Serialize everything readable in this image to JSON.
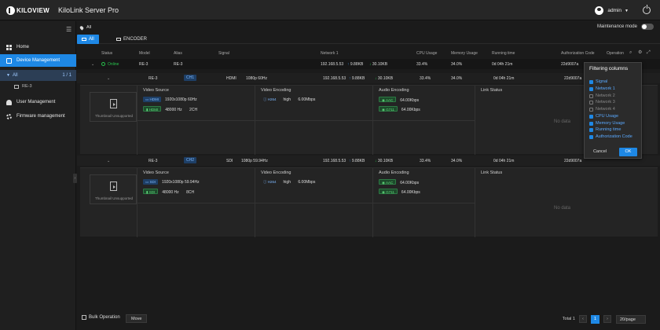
{
  "header": {
    "logo_text": "KILOVIEW",
    "app_title": "KiloLink Server Pro",
    "user_name": "admin"
  },
  "sidebar": {
    "items": [
      {
        "label": "Home",
        "icon": "home-icon"
      },
      {
        "label": "Device Management",
        "icon": "device-icon"
      },
      {
        "label": "User Management",
        "icon": "user-icon"
      },
      {
        "label": "Firmware management",
        "icon": "gear-icon"
      }
    ],
    "tree_all_label": "All",
    "tree_all_count": "1 / 1",
    "tree_device": "RE-3"
  },
  "filter_bar": {
    "location": "All",
    "maintenance_label": "Maintenance mode",
    "maintenance_on": false
  },
  "tabs": [
    {
      "label": "All",
      "active": true
    },
    {
      "label": "ENCODER",
      "active": false
    }
  ],
  "table": {
    "columns": {
      "status": "Status",
      "model": "Model",
      "alias": "Alias",
      "signal": "Signal",
      "network1": "Network 1",
      "cpu": "CPU Usage",
      "memory": "Memory Usage",
      "running": "Running time",
      "auth": "Authorization Code",
      "operation": "Operation"
    },
    "device_row": {
      "status": "Online",
      "model": "RE-3",
      "alias": "RE-3",
      "ip": "192.168.5.53",
      "up": "9.88KB",
      "down": "30.10KB",
      "cpu": "33.4%",
      "memory": "34.0%",
      "running": "0d 04h 21m",
      "auth": "22d9007a"
    },
    "channels": [
      {
        "model": "RE-3",
        "channel": "CH1",
        "signal_type": "HDMI",
        "signal": "1080p 60Hz",
        "ip": "192.168.5.53",
        "up": "9.88KB",
        "down": "30.10KB",
        "cpu": "33.4%",
        "memory": "34.0%",
        "running": "0d 04h 21m",
        "auth": "22d9007a",
        "thumbnail_label": "Thumbnail Unsupported",
        "video_source_title": "Video Source",
        "video_source_tag": "HDMI",
        "video_source_res": "1920x1080p 60Hz",
        "audio_source_tag": "HDMI",
        "audio_source_rate": "48000 Hz",
        "audio_source_ch": "2CH",
        "video_enc_title": "Video Encoding",
        "video_enc_codec": "H264",
        "video_enc_profile": "high",
        "video_enc_bitrate": "6.00Mbps",
        "audio_enc_title": "Audio Encoding",
        "audio_enc_codec1": "AAC",
        "audio_enc_rate1": "64.00Kbps",
        "audio_enc_codec2": "G711",
        "audio_enc_rate2": "64.00Kbps",
        "link_status_title": "Link Status",
        "no_data": "No data"
      },
      {
        "model": "RE-3",
        "channel": "CH2",
        "signal_type": "SDI",
        "signal": "1080p 59.94Hz",
        "ip": "192.168.5.53",
        "up": "9.88KB",
        "down": "30.10KB",
        "cpu": "33.4%",
        "memory": "34.0%",
        "running": "0d 04h 21m",
        "auth": "22d9007a",
        "thumbnail_label": "Thumbnail Unsupported",
        "video_source_title": "Video Source",
        "video_source_tag": "SDI",
        "video_source_res": "1920x1080p 59.94Hz",
        "audio_source_tag": "SDI",
        "audio_source_rate": "48000 Hz",
        "audio_source_ch": "8CH",
        "video_enc_title": "Video Encoding",
        "video_enc_codec": "H264",
        "video_enc_profile": "high",
        "video_enc_bitrate": "6.00Mbps",
        "audio_enc_title": "Audio Encoding",
        "audio_enc_codec1": "AAC",
        "audio_enc_rate1": "64.00Kbps",
        "audio_enc_codec2": "G711",
        "audio_enc_rate2": "64.00Kbps",
        "link_status_title": "Link Status",
        "no_data": "No data"
      }
    ]
  },
  "filter_panel": {
    "title": "Filtering columns",
    "items": [
      {
        "label": "Signal",
        "checked": true
      },
      {
        "label": "Network 1",
        "checked": true
      },
      {
        "label": "Network 2",
        "checked": false
      },
      {
        "label": "Network 3",
        "checked": false
      },
      {
        "label": "Network 4",
        "checked": false
      },
      {
        "label": "CPU Usage",
        "checked": true
      },
      {
        "label": "Memory Usage",
        "checked": true
      },
      {
        "label": "Running time",
        "checked": true
      },
      {
        "label": "Authorization Code",
        "checked": true
      }
    ],
    "cancel_label": "Cancel",
    "ok_label": "OK"
  },
  "footer": {
    "bulk_label": "Bulk Operation",
    "move_label": "Move",
    "total_label": "Total 1",
    "current_page": "1",
    "page_size": "20/page"
  },
  "colors": {
    "accent": "#1e88e5",
    "online": "#27c24c",
    "background": "#1b1b1b"
  }
}
